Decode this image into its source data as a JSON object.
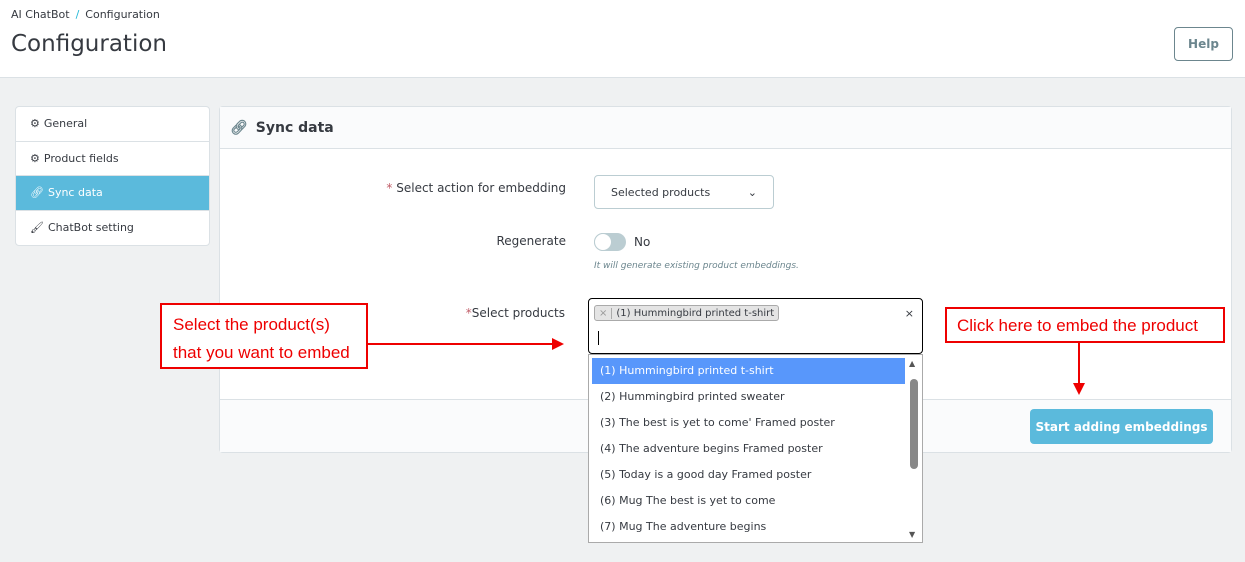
{
  "breadcrumb": {
    "parent": "AI ChatBot",
    "separator": "/",
    "current": "Configuration"
  },
  "header": {
    "title": "Configuration",
    "help_label": "Help"
  },
  "sidebar": {
    "items": [
      {
        "label": "General",
        "icon": "gears-icon"
      },
      {
        "label": "Product fields",
        "icon": "gear-icon"
      },
      {
        "label": "Sync data",
        "icon": "link-icon",
        "active": true
      },
      {
        "label": "ChatBot setting",
        "icon": "brush-icon"
      }
    ]
  },
  "panel": {
    "title": "Sync data",
    "action_label": "Select action for embedding",
    "action_value": "Selected products",
    "regenerate_label": "Regenerate",
    "regenerate_value": "No",
    "regenerate_help": "It will generate existing product embeddings.",
    "products_label": "Select products",
    "selected_chip": "(1) Hummingbird printed t-shirt",
    "options": [
      "(1) Hummingbird printed t-shirt",
      "(2) Hummingbird printed sweater",
      "(3) The best is yet to come' Framed poster",
      "(4) The adventure begins Framed poster",
      "(5) Today is a good day Framed poster",
      "(6) Mug The best is yet to come",
      "(7) Mug The adventure begins"
    ],
    "start_label": "Start adding embeddings"
  },
  "annotations": {
    "left_line1": "Select the product(s)",
    "left_line2": "that you want to embed",
    "right": "Click here to embed the product"
  },
  "colors": {
    "accent": "#5bbadc",
    "highlight": "#5897fb",
    "annotation": "#e00000"
  }
}
